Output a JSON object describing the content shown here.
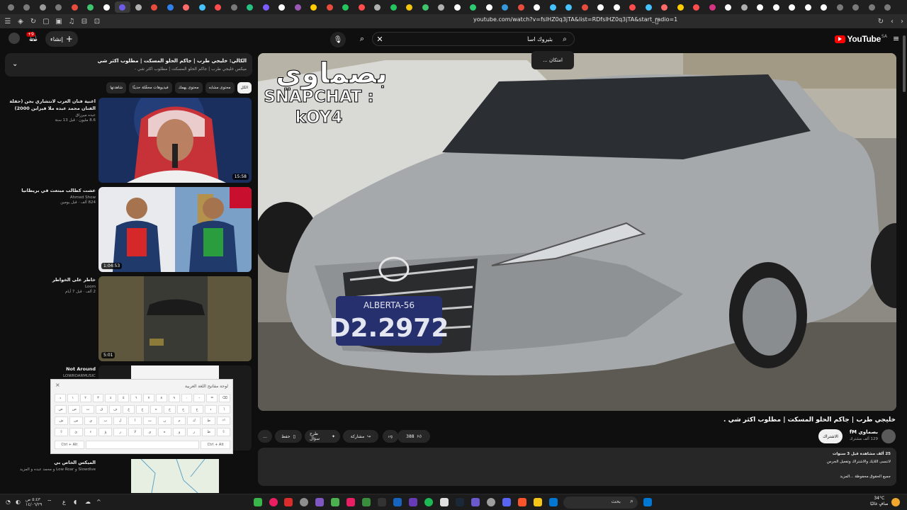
{
  "browser": {
    "url": "youtube.com/watch?v=fslHZ0q3jTA&list=RDfslHZ0q3jTA&start_radio=1",
    "tab_favicon_colors": [
      "#7a7a7a",
      "#7a7a7a",
      "#9a9a9a",
      "#7a7a7a",
      "#e84c3d",
      "#3ec46d",
      "#ffffff",
      "#6c5ce7",
      "#b0b0b0",
      "#e84c3d",
      "#2f80ed",
      "#ff6b6b",
      "#46c2ff",
      "#ff4d4d",
      "#7a7a7a",
      "#26c281",
      "#7d5cff",
      "#ffffff",
      "#9b59b6",
      "#ffcc00",
      "#e84c3d",
      "#22c55e",
      "#ff4d4d",
      "#b0b0b0",
      "#22c55e",
      "#f1c40f",
      "#3ec46d",
      "#b0b0b0",
      "#ffffff",
      "#2ecc71",
      "#ffffff",
      "#3498db",
      "#e84c3d",
      "#ffffff",
      "#46c2ff",
      "#46c2ff",
      "#e84c3d",
      "#ffffff",
      "#ffffff",
      "#ff4d4d",
      "#46c2ff",
      "#ff6b6b",
      "#ffcc00",
      "#ff4d4d",
      "#d63384",
      "#ffffff",
      "#b0b0b0",
      "#ffffff",
      "#ffffff",
      "#ffffff",
      "#ffffff",
      "#ffffff",
      "#7a7a7a",
      "#7a7a7a",
      "#7a7a7a",
      "#7a7a7a"
    ]
  },
  "header": {
    "logo_text": "YouTube",
    "logo_region": "SA",
    "search_value": "بثيروك اسأ",
    "suggestion": "... امتكان",
    "create_label": "إنشاء",
    "notification_count": "+9"
  },
  "playlist": {
    "title": "الكالي: خليجي طرب | جاكم الحلو المسكت | مطلوب اكثر شي",
    "subtitle": "ميكس خليجي طرب | جاكم الحلو المسكت | مطلوب اكثر شي -"
  },
  "chips": [
    "الكل",
    "محتوى مشابه",
    "محتوى يهمك",
    "فيديوهات محمَّلة حديثًا",
    "شاهدتها"
  ],
  "recommendations": [
    {
      "title": "اغنية فنان العرب لانتشاري بجن (حفلة الفنان محمد عبده ملا فيزاين 2000)",
      "channel": "عبده ميرزاق",
      "stats": "8.6 مليون · قبل 13 سنة",
      "duration": "15:58"
    },
    {
      "title": "عشت كطالب مبتعث في بريطانيا",
      "channel": "Ahmed Show",
      "stats": "824 ألف · قبل يومين",
      "duration": "1:04:53"
    },
    {
      "title": "خاطر على الخواطر",
      "channel": "Loom",
      "stats": "2 ألف · قبل 7 أيام",
      "duration": "5:01"
    },
    {
      "title": "Not Around",
      "channel": "LOWROARMUSIC",
      "stats": "",
      "duration": ""
    },
    {
      "title": "الميكس الخاص بي",
      "channel": "Slowdive و Low Roar و محمد عبده و المزيد",
      "stats": "",
      "duration": ""
    }
  ],
  "keyboard": {
    "title": "لوحة مفاتيح اللغة العربية",
    "row1": [
      "ذ",
      "١",
      "٢",
      "٣",
      "٤",
      "٥",
      "٦",
      "٧",
      "٨",
      "٩",
      "٠",
      "-",
      "=",
      "⌫"
    ],
    "row2": [
      "ض",
      "ص",
      "ث",
      "ق",
      "ف",
      "غ",
      "ع",
      "ه",
      "خ",
      "ح",
      "ج",
      "د",
      "\\"
    ],
    "row3": [
      "ش",
      "س",
      "ي",
      "ب",
      "ل",
      "ا",
      "ت",
      "ن",
      "م",
      "ك",
      "ط",
      "⏎"
    ],
    "row4": [
      "⇧",
      "ئ",
      "ء",
      "ؤ",
      "ر",
      "لا",
      "ى",
      "ة",
      "و",
      "ز",
      "ظ",
      "⇧"
    ],
    "ctrl_left": "Ctrl + Alt",
    "ctrl_right": "Ctrl + Alt"
  },
  "video": {
    "overlay_name": "بصماوي",
    "overlay_snap_line1": "SNAPCHAT :",
    "overlay_snap_line2": "kOY4",
    "plate_top": "ALBERTA-56",
    "plate_number": "D2.2972",
    "title": "خليجي طرب | جاكم الحلو المسكت | مطلوب اكثر شي .",
    "channel": "بصماوي fM",
    "subscribers": "129 ألف مشترك",
    "join_label": "الاشتراك",
    "likes": "388",
    "share_label": "مشاركة",
    "ask_label": "طرح سؤال",
    "save_label": "حفظ",
    "more_label": "..."
  },
  "description": {
    "line1": "25 ألف مشاهدة قبل 3 سنوات",
    "line2": "لاتنسى اللايك والاشتراك وتفعيل الجرس",
    "line3": "جميع الحقوق محفوظة ...المزيد"
  },
  "taskbar": {
    "search_placeholder": "بحث",
    "time": "٥:٤٣ ص",
    "date": "١٤/٠٦/٢٩",
    "temp": "34°C",
    "weather": "صافٍ غالبًا"
  }
}
